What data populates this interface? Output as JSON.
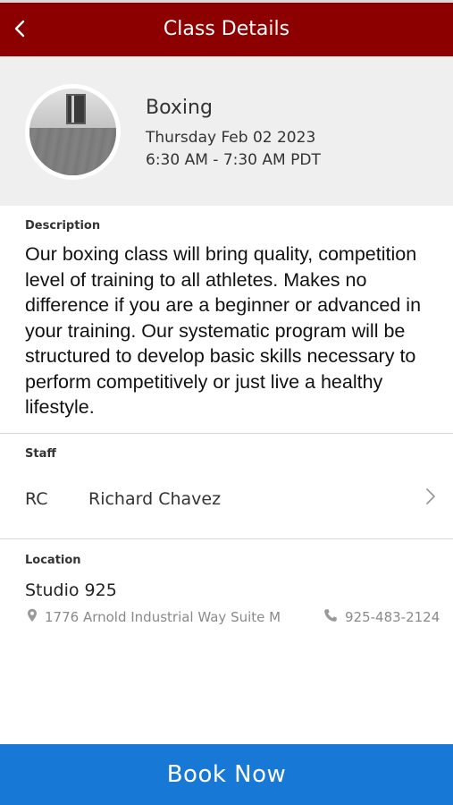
{
  "header": {
    "title": "Class Details",
    "back_icon": "chevron-left-icon",
    "background": "#8d0000"
  },
  "class": {
    "name": "Boxing",
    "date": "Thursday Feb 02 2023",
    "time": "6:30 AM - 7:30 AM PDT"
  },
  "description": {
    "label": "Description",
    "text": "Our boxing class will bring quality, competition level of training to all athletes.  Makes no difference if you are a beginner or advanced in your training. Our systematic program will be structured to develop basic skills necessary to perform competitively or just live a healthy lifestyle."
  },
  "staff": {
    "label": "Staff",
    "initials": "RC",
    "name": "Richard Chavez",
    "chevron_icon": "chevron-right-icon"
  },
  "location": {
    "label": "Location",
    "name": "Studio 925",
    "address": "1776 Arnold Industrial Way Suite M",
    "phone": "925-483-2124",
    "address_icon": "map-pin-icon",
    "phone_icon": "phone-icon"
  },
  "book_button": {
    "label": "Book Now",
    "color": "#1778d6"
  }
}
